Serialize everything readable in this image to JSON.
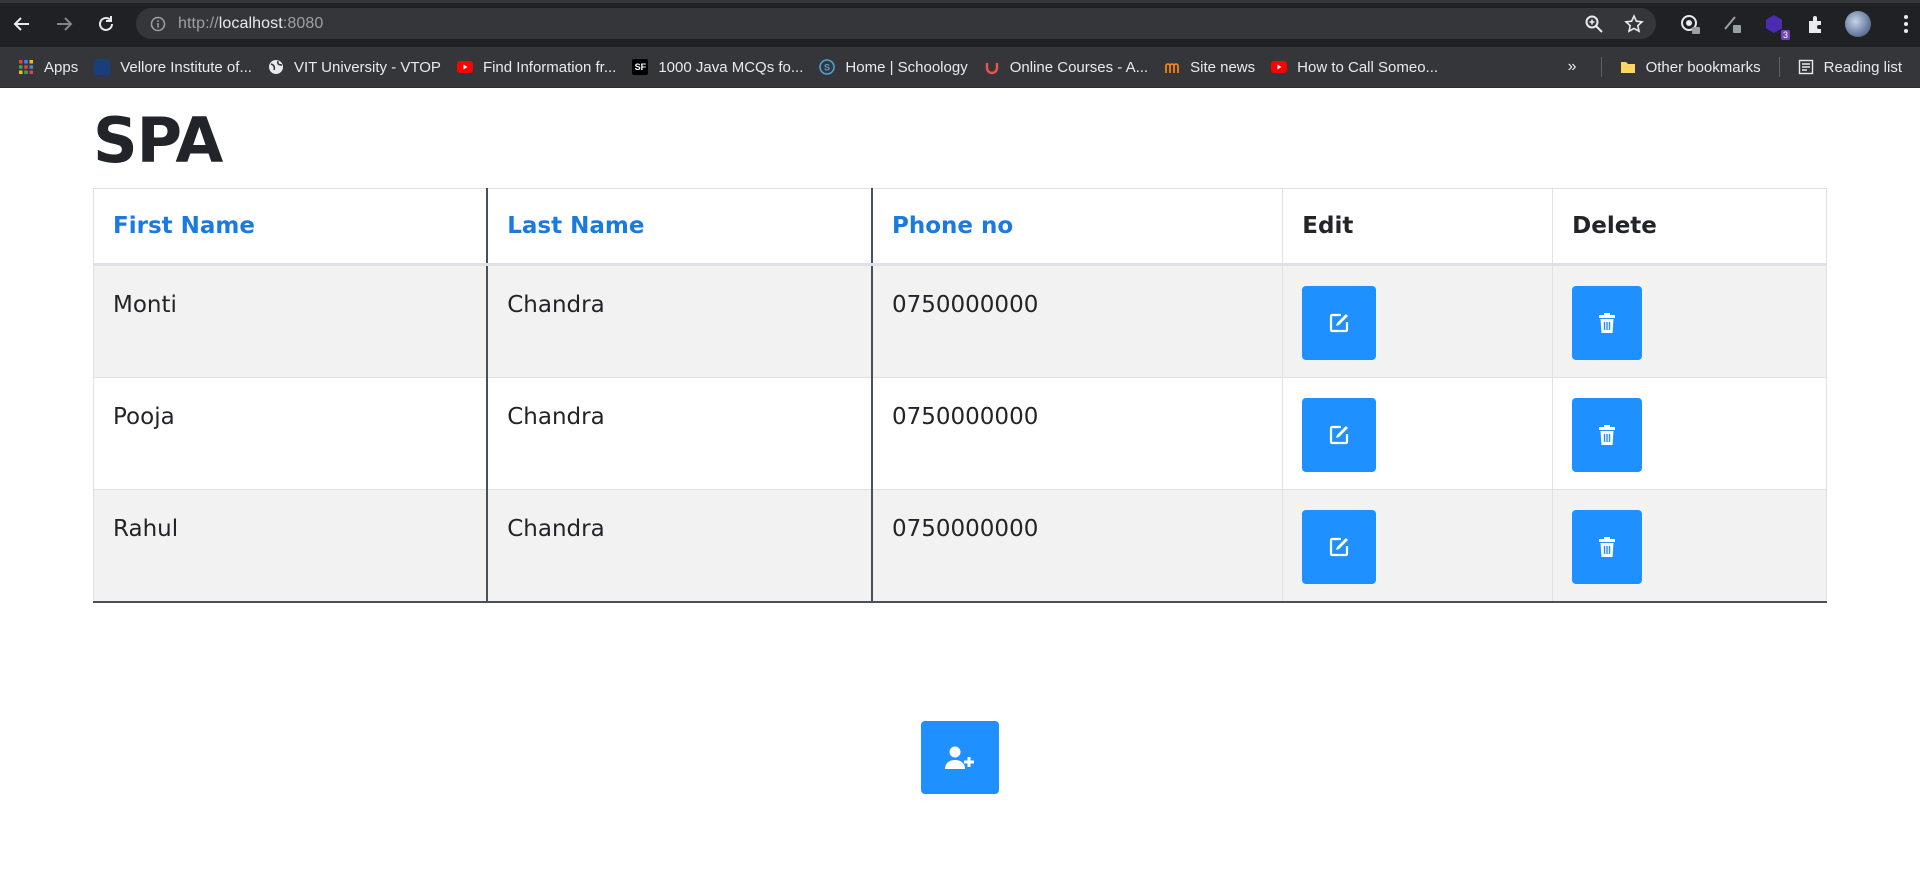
{
  "browser": {
    "url_scheme": "http://",
    "url_host": "localhost",
    "url_port": ":8080",
    "extension_badge": "3",
    "bookmarks": [
      {
        "label": "Apps",
        "icon": "apps-grid-icon",
        "color": "#4285f4"
      },
      {
        "label": "Vellore Institute of...",
        "icon": "vit-logo-icon",
        "color": "#1a3d7c"
      },
      {
        "label": "VIT University - VTOP",
        "icon": "globe-icon",
        "color": "#e8eaed"
      },
      {
        "label": "Find Information fr...",
        "icon": "youtube-icon",
        "color": "#ff0000"
      },
      {
        "label": "1000 Java MCQs fo...",
        "icon": "sanfoundry-icon",
        "color": "#000000"
      },
      {
        "label": "Home | Schoology",
        "icon": "schoology-icon",
        "color": "#4fa3d1"
      },
      {
        "label": "Online Courses - A...",
        "icon": "udemy-icon",
        "color": "#ec5252"
      },
      {
        "label": "Site news",
        "icon": "moodle-icon",
        "color": "#f98012"
      },
      {
        "label": "How to Call Someo...",
        "icon": "youtube-icon",
        "color": "#ff0000"
      }
    ],
    "other_bookmarks": "Other bookmarks",
    "reading_list": "Reading list",
    "overflow": "»"
  },
  "page": {
    "title": "SPA",
    "columns": [
      "First Name",
      "Last Name",
      "Phone no",
      "Edit",
      "Delete"
    ],
    "rows": [
      {
        "first": "Monti",
        "last": "Chandra",
        "phone": "0750000000"
      },
      {
        "first": "Pooja",
        "last": "Chandra",
        "phone": "0750000000"
      },
      {
        "first": "Rahul",
        "last": "Chandra",
        "phone": "0750000000"
      }
    ],
    "accent_color": "#1e90ff",
    "header_link_color": "#1a7ae0"
  }
}
